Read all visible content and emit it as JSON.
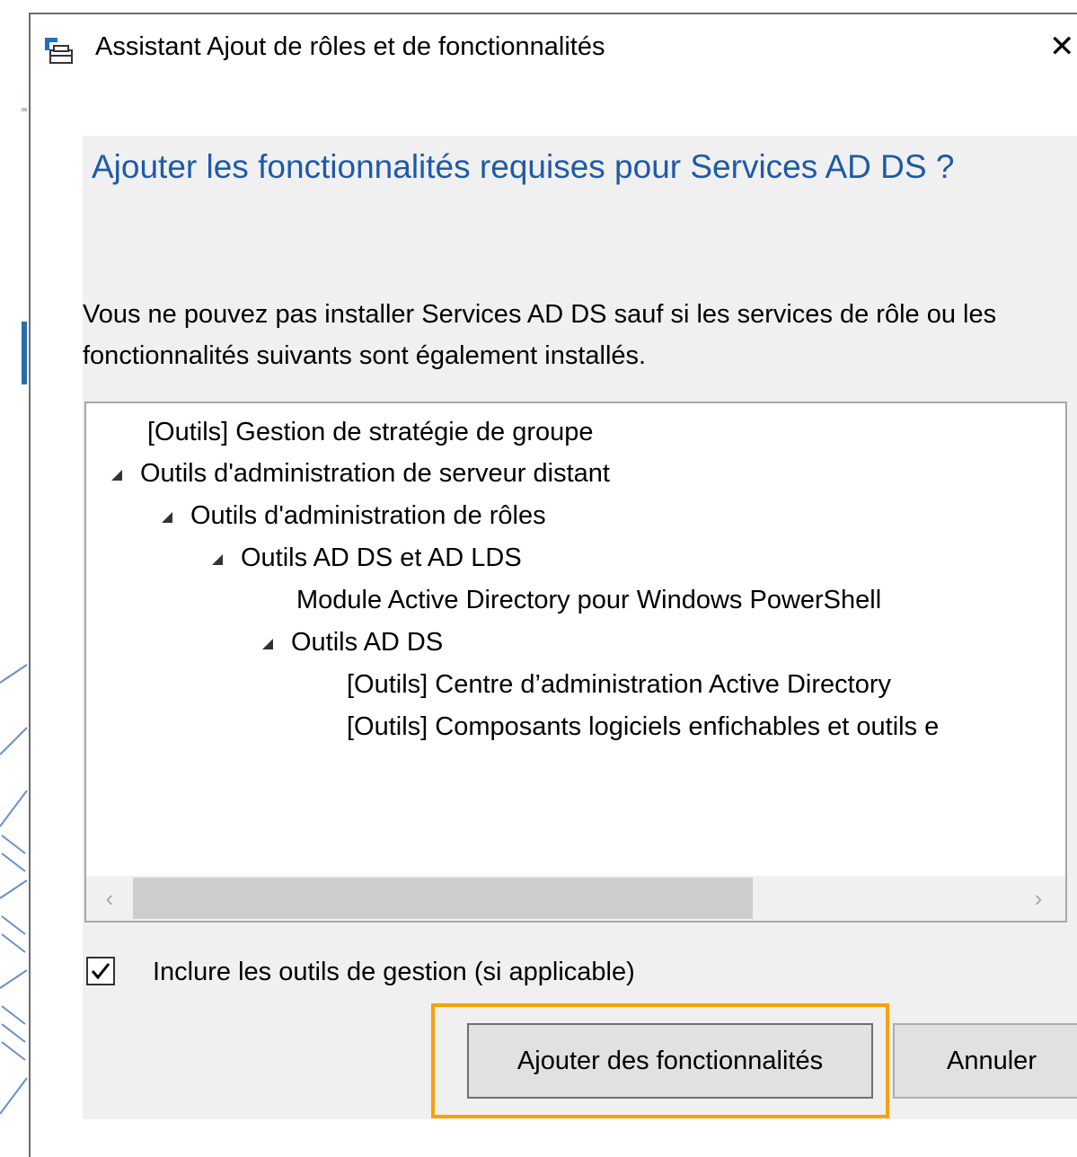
{
  "window": {
    "title": "Assistant Ajout de rôles et de fonctionnalités",
    "close_glyph": "✕",
    "icon": "server-manager-icon"
  },
  "dialog": {
    "heading": "Ajouter les fonctionnalités requises pour Services AD DS ?",
    "description": "Vous ne pouvez pas installer Services AD DS sauf si les services de rôle ou les fonctionnalités suivants sont également installés."
  },
  "tree": {
    "items": [
      {
        "label": "[Outils] Gestion de stratégie de groupe",
        "level": 0,
        "expanded": false
      },
      {
        "label": "Outils d'administration de serveur distant",
        "level": 0,
        "expanded": true
      },
      {
        "label": "Outils d'administration de rôles",
        "level": 1,
        "expanded": true
      },
      {
        "label": "Outils AD DS et AD LDS",
        "level": 2,
        "expanded": true
      },
      {
        "label": "Module Active Directory pour Windows PowerShell",
        "level": 3,
        "expanded": false
      },
      {
        "label": "Outils AD DS",
        "level": 3,
        "expanded": true
      },
      {
        "label": "[Outils] Centre d’administration Active Directory",
        "level": 4,
        "expanded": false
      },
      {
        "label": "[Outils] Composants logiciels enfichables et outils e",
        "level": 4,
        "expanded": false
      }
    ],
    "scroll_left": "‹",
    "scroll_right": "›"
  },
  "options": {
    "include_tools_label": "Inclure les outils de gestion (si applicable)",
    "include_tools_checked": true
  },
  "buttons": {
    "add_label": "Ajouter des fonctionnalités",
    "cancel_label": "Annuler"
  },
  "colors": {
    "heading": "#1e5aa8",
    "highlight": "#f7a200"
  }
}
